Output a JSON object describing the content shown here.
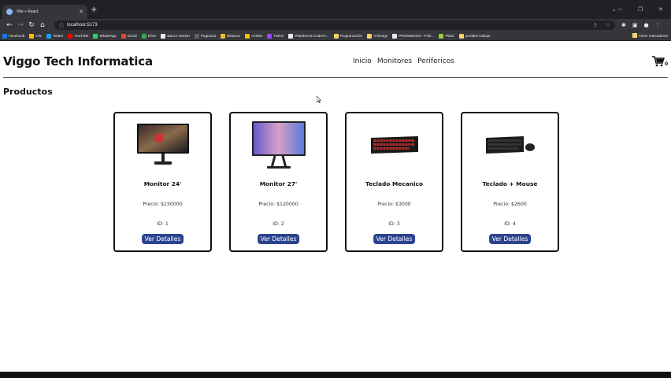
{
  "browser": {
    "tab_title": "Vite + React",
    "url": "localhost:5173",
    "bookmarks": [
      {
        "label": "Facebook",
        "color": "#1877f2"
      },
      {
        "label": "CW",
        "color": "#fbbc04"
      },
      {
        "label": "Twitter",
        "color": "#1da1f2"
      },
      {
        "label": "YouTube",
        "color": "#ff0000"
      },
      {
        "label": "WhatsApp",
        "color": "#25d366"
      },
      {
        "label": "Gmail",
        "color": "#ea4335"
      },
      {
        "label": "Drive",
        "color": "#34a853"
      },
      {
        "label": "Banco Nación",
        "color": "#e8eaed"
      },
      {
        "label": "Pagina12",
        "color": "#5f6368"
      },
      {
        "label": "Binance",
        "color": "#f3ba2f"
      },
      {
        "label": "Ambito",
        "color": "#fbbc04"
      },
      {
        "label": "Twitch",
        "color": "#9146ff"
      },
      {
        "label": "Plataforma CoderH...",
        "color": "#e8eaed"
      },
      {
        "label": "Programación",
        "color": "#f4d36a"
      },
      {
        "label": "Aristotge",
        "color": "#f4d36a"
      },
      {
        "label": "PROMIEDOS - Fútb...",
        "color": "#e8eaed"
      },
      {
        "label": "Platzi",
        "color": "#98ca3f"
      },
      {
        "label": "portales trabajo",
        "color": "#f4d36a"
      }
    ],
    "other_bookmarks": "Otros marcadores"
  },
  "site": {
    "title": "Viggo Tech Informatica",
    "nav": [
      "Inicio",
      "Monitores",
      "Perifericos"
    ],
    "cart_count": "0",
    "section_title": "Productos"
  },
  "products": [
    {
      "name": "Monitor 24'",
      "price": "Precio: $150000",
      "id": "ID: 1",
      "button": "Ver Detalles",
      "image": "monitor-24-icon"
    },
    {
      "name": "Monitor 27'",
      "price": "Precio: $120000",
      "id": "ID: 2",
      "button": "Ver Detalles",
      "image": "monitor-27-icon"
    },
    {
      "name": "Teclado Mecanico",
      "price": "Precio: $3000",
      "id": "ID: 3",
      "button": "Ver Detalles",
      "image": "keyboard-icon"
    },
    {
      "name": "Teclado + Mouse",
      "price": "Precio: $2600",
      "id": "ID: 4",
      "button": "Ver Detalles",
      "image": "keyboard-mouse-icon"
    }
  ],
  "colors": {
    "button": "#2b4490",
    "chrome_dark": "#202124",
    "chrome": "#35363a"
  }
}
